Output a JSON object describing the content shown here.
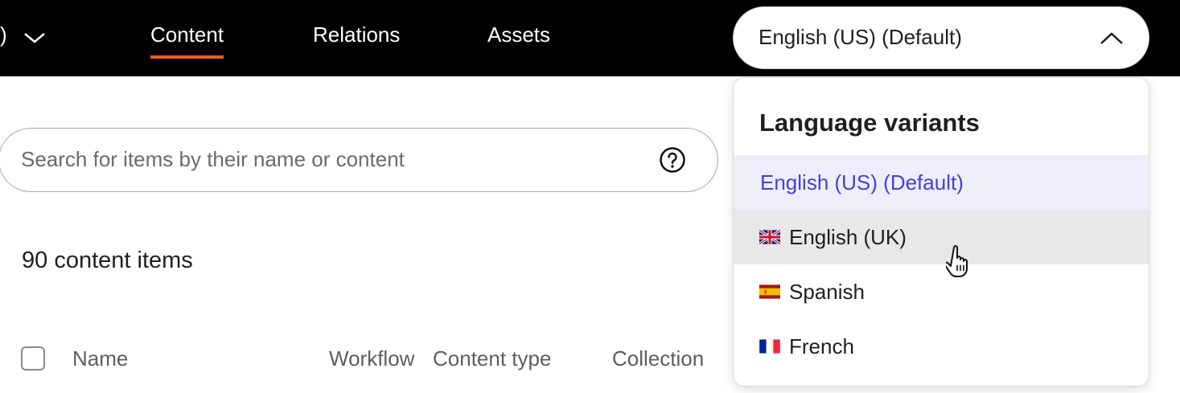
{
  "header": {
    "project_tail": ")",
    "tabs": [
      {
        "label": "Content",
        "active": true
      },
      {
        "label": "Relations",
        "active": false
      },
      {
        "label": "Assets",
        "active": false
      }
    ],
    "language_select": {
      "value": "English (US) (Default)",
      "icon": "chevron-up-icon"
    },
    "accent_color": "#f05a28"
  },
  "search": {
    "placeholder": "Search for items by their name or content",
    "value": "",
    "help_icon": "question-circle-icon"
  },
  "content": {
    "count_label": "90 content items",
    "columns": [
      "Name",
      "Workflow",
      "Content type",
      "Collection"
    ]
  },
  "dropdown": {
    "heading": "Language variants",
    "options": [
      {
        "label": "English (US) (Default)",
        "flag": "",
        "state": "selected"
      },
      {
        "label": "English (UK)",
        "flag": "uk-flag-icon",
        "state": "hover"
      },
      {
        "label": "Spanish",
        "flag": "spain-flag-icon",
        "state": ""
      },
      {
        "label": "French",
        "flag": "france-flag-icon",
        "state": ""
      }
    ],
    "selected_color": "#4a3ddb"
  }
}
